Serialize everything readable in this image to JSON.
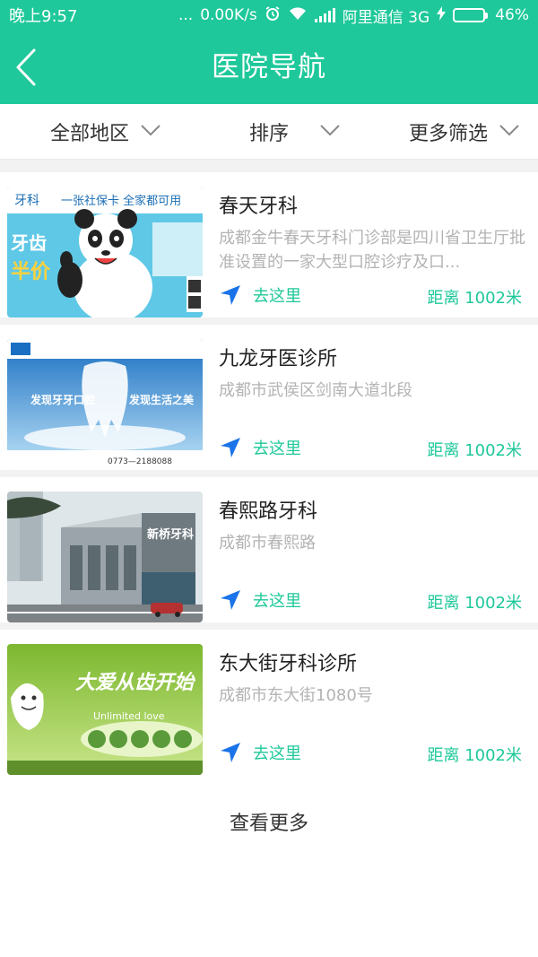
{
  "status_bar": {
    "time": "晚上9:57",
    "dots": "...",
    "speed": "0.00K/s",
    "carrier": "阿里通信 3G",
    "battery": "46%"
  },
  "header": {
    "title": "医院导航",
    "back_icon": "chevron-left-icon"
  },
  "filters": [
    {
      "label": "全部地区"
    },
    {
      "label": "排序"
    },
    {
      "label": "更多筛选"
    }
  ],
  "items": [
    {
      "name": "春天牙科",
      "address": "成都金牛春天牙科门诊部是四川省卫生厅批准设置的一家大型口腔诊疗及口...",
      "go_label": "去这里",
      "distance": "距离 1002米",
      "thumb": {
        "headline": "一张社保卡 全家都可用",
        "brand": "牙科",
        "tag1": "牙齿",
        "tag2": "半价"
      }
    },
    {
      "name": "九龙牙医诊所",
      "address": "成都市武侯区剑南大道北段",
      "go_label": "去这里",
      "distance": "距离 1002米",
      "thumb": {
        "tag1": "发现牙牙口腔",
        "tag2": "发现生活之美",
        "phone": "0773—2188088"
      }
    },
    {
      "name": "春熙路牙科",
      "address": "成都市春熙路",
      "go_label": "去这里",
      "distance": "距离 1002米",
      "thumb": {
        "sign": "新桥牙科"
      }
    },
    {
      "name": "东大街牙科诊所",
      "address": "成都市东大街1080号",
      "go_label": "去这里",
      "distance": "距离 1002米",
      "thumb": {
        "slogan": "大爱从齿开始",
        "sub": "Unlimited love"
      }
    }
  ],
  "load_more": "查看更多",
  "colors": {
    "accent": "#1ec89a",
    "nav_arrow": "#1a73e8"
  }
}
